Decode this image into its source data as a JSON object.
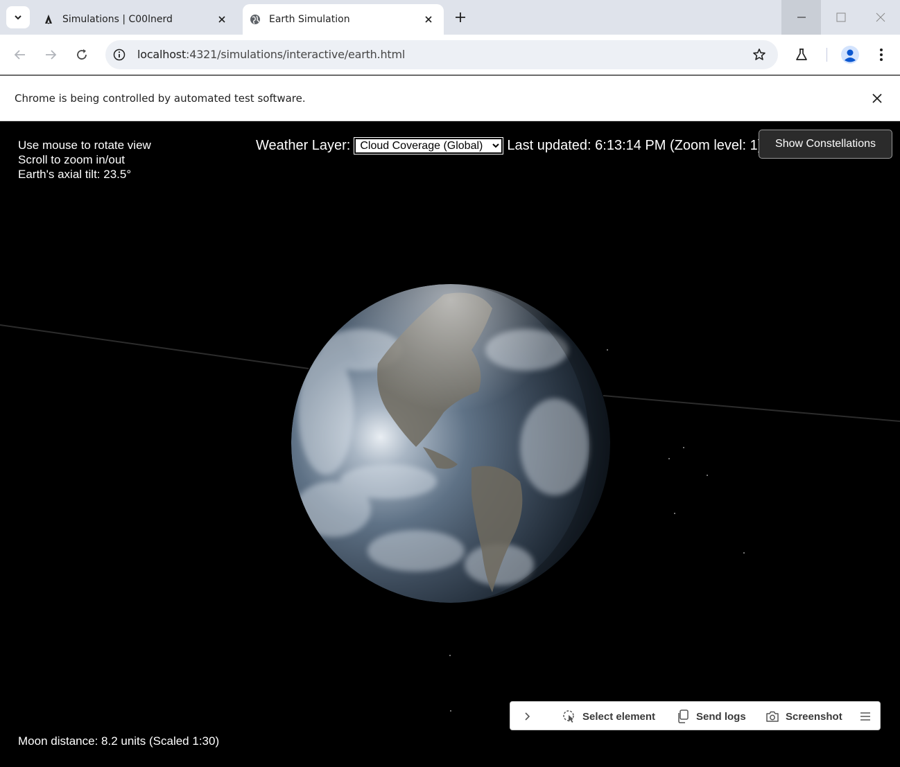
{
  "browser": {
    "tabs": [
      {
        "title": "Simulations | C00lnerd",
        "active": false,
        "favicon": "astro-icon"
      },
      {
        "title": "Earth Simulation",
        "active": true,
        "favicon": "globe-icon"
      }
    ],
    "address": {
      "host": "localhost",
      "path": ":4321/simulations/interactive/earth.html"
    },
    "infobar_text": "Chrome is being controlled by automated test software."
  },
  "hud": {
    "help_lines": [
      "Use mouse to rotate view",
      "Scroll to zoom in/out",
      "Earth's axial tilt: 23.5°"
    ],
    "weather_label": "Weather Layer:",
    "weather_selected": "Cloud Coverage (Global)",
    "last_updated": "Last updated: 6:13:14 PM (Zoom level: 1)",
    "constellations_button": "Show Constellations",
    "moon_distance": "Moon distance: 8.2 units (Scaled 1:30)"
  },
  "devtools_bar": {
    "select_element": "Select element",
    "send_logs": "Send logs",
    "screenshot": "Screenshot"
  },
  "colors": {
    "tabstrip": "#dfe3eb",
    "omnibox": "#edf0f5",
    "space": "#000000",
    "button_dark": "#2b2b2b"
  }
}
